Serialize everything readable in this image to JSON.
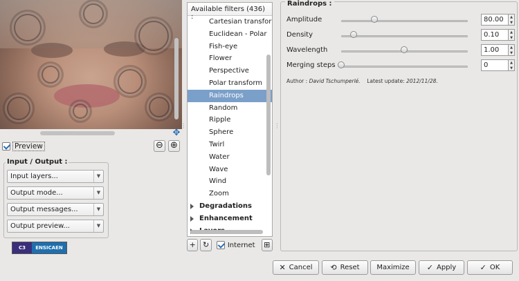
{
  "preview": {
    "label": "Preview",
    "checked": true,
    "zoom_out": "⊖",
    "zoom_in": "⊕"
  },
  "io": {
    "title": "Input / Output :",
    "combos": [
      "Input layers...",
      "Output mode...",
      "Output messages...",
      "Output preview..."
    ]
  },
  "logo": {
    "left_text": "C3",
    "right_text": "ENSICAEN"
  },
  "filters": {
    "header": "Available filters (436) :",
    "items": [
      "Cartesian transform",
      "Euclidean - Polar",
      "Fish-eye",
      "Flower",
      "Perspective",
      "Polar transform",
      "Raindrops",
      "Random",
      "Ripple",
      "Sphere",
      "Twirl",
      "Water",
      "Wave",
      "Wind",
      "Zoom"
    ],
    "selected": "Raindrops",
    "categories": [
      "Degradations",
      "Enhancement",
      "Layers"
    ],
    "internet_label": "Internet",
    "internet_checked": true
  },
  "params": {
    "title": "Raindrops :",
    "rows": [
      {
        "label": "Amplitude",
        "value": "80.00",
        "fraction": 0.25
      },
      {
        "label": "Density",
        "value": "0.10",
        "fraction": 0.09
      },
      {
        "label": "Wavelength",
        "value": "1.00",
        "fraction": 0.5
      },
      {
        "label": "Merging steps",
        "value": "0",
        "fraction": 0.0
      }
    ],
    "author_label": "Author :",
    "author_name": "David Tschumperlé.",
    "update_label": "Latest update:",
    "update_date": "2012/11/28."
  },
  "buttons": {
    "cancel": "Cancel",
    "reset": "Reset",
    "maximize": "Maximize",
    "apply": "Apply",
    "ok": "OK"
  }
}
